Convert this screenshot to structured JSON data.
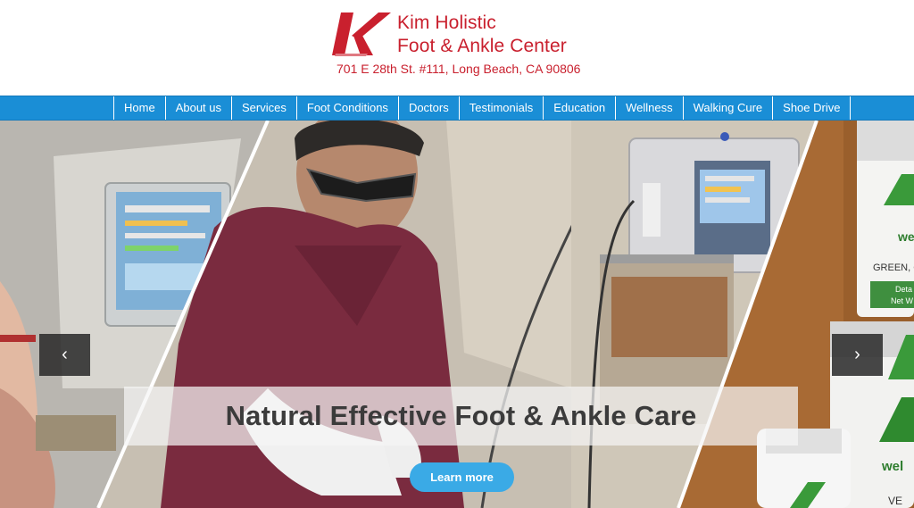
{
  "brand": {
    "name_line1": "Kim Holistic",
    "name_line2": "Foot & Ankle Center",
    "address": "701 E 28th St. #111, Long Beach, CA 90806",
    "logo_icon": "kim-k-logo-icon",
    "color": "#c9202e"
  },
  "nav": {
    "color": "#1a8ed6",
    "items": [
      {
        "label": "Home"
      },
      {
        "label": "About us"
      },
      {
        "label": "Services"
      },
      {
        "label": "Foot Conditions"
      },
      {
        "label": "Doctors"
      },
      {
        "label": "Testimonials"
      },
      {
        "label": "Education"
      },
      {
        "label": "Wellness"
      },
      {
        "label": "Walking Cure"
      },
      {
        "label": "Shoe Drive"
      }
    ]
  },
  "hero": {
    "caption": "Natural Effective Foot & Ankle Care",
    "button_label": "Learn more",
    "button_color": "#3aaae6",
    "prev_icon": "chevron-left-icon",
    "next_icon": "chevron-right-icon",
    "prev_glyph": "‹",
    "next_glyph": "›",
    "bottle_text_1": "we",
    "bottle_text_2": "GREEN, G",
    "bottle_text_3": "Deta",
    "bottle_text_4": "Net W",
    "bottle_text_5": "wel",
    "bottle_text_6": "VE"
  }
}
